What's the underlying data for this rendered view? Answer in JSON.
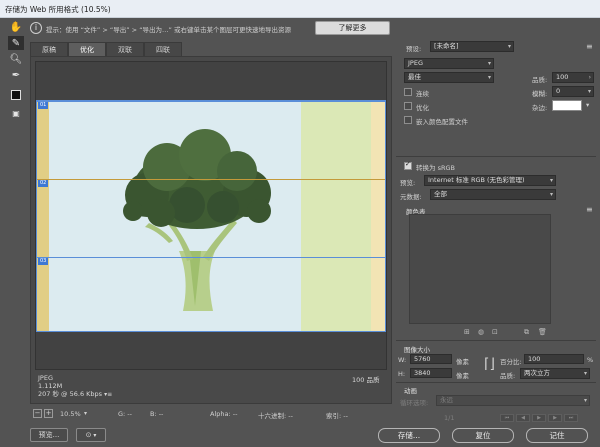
{
  "window": {
    "title": "存储为 Web 所用格式 (10.5%)"
  },
  "tip": {
    "text": "提示：使用 “文件” > “导出” > “导出为…” 或右键单击某个图层可更快速地导出资源",
    "learn_more": "了解更多"
  },
  "tabs": [
    "原稿",
    "优化",
    "双联",
    "四联"
  ],
  "active_tab": "优化",
  "slices": [
    {
      "label": "01",
      "color": "#3d78d4"
    },
    {
      "label": "02",
      "color": "#3d78d4"
    },
    {
      "label": "03",
      "color": "#3d78d4"
    }
  ],
  "image_meta": {
    "format": "JPEG",
    "size": "1.112M",
    "time": "207 秒 @ 56.6 Kbps",
    "quality": "100 品质"
  },
  "status": {
    "zoom": "10.5%",
    "g": "G: --",
    "b": "B: --",
    "alpha": "Alpha: --",
    "hex": "十六进制: --",
    "index": "索引: --"
  },
  "buttons": {
    "preview": "预览...",
    "save": "存储...",
    "reset": "复位",
    "remember": "记住"
  },
  "panel": {
    "preset_label": "预设:",
    "preset_value": "[未命名]",
    "format": "JPEG",
    "quality_preset": "最佳",
    "quality_label": "品质:",
    "quality_value": "100",
    "blur_label": "模糊:",
    "blur_value": "0",
    "matte_label": "杂边:",
    "progressive": "连续",
    "optimized": "优化",
    "embed_profile": "嵌入颜色配置文件",
    "convert_srgb": "转换为 sRGB",
    "preview_label": "预览:",
    "preview_value": "Internet 标准 RGB (无色彩管理)",
    "metadata_label": "元数据:",
    "metadata_value": "全部",
    "color_table": "颜色表",
    "image_size": "图像大小",
    "w_label": "W:",
    "w_value": "5760",
    "h_label": "H:",
    "h_value": "3840",
    "px": "像素",
    "percent_label": "百分比:",
    "percent_value": "100",
    "pct": "%",
    "quality2_label": "品质:",
    "quality2_value": "两次立方",
    "animation": "动画",
    "loop_label": "循环选项:",
    "loop_value": "永远",
    "frame": "1/1"
  }
}
